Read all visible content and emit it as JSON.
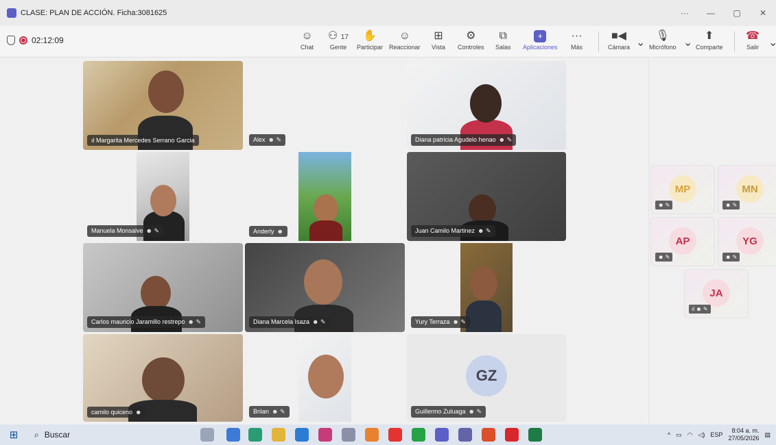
{
  "window": {
    "title": "CLASE: PLAN DE ACCIÓN. Ficha:3081625",
    "controls": [
      "···",
      "—",
      "▢",
      "✕"
    ]
  },
  "meeting": {
    "timer": "02:12:09",
    "participants_count": "17"
  },
  "toolbar": {
    "chat": "Chat",
    "people": "Gente",
    "raise": "Participar",
    "react": "Reaccionar",
    "view": "Vista",
    "controls": "Controles",
    "rooms": "Salas",
    "apps": "Aplicaciones",
    "more": "Más",
    "camera": "Cámara",
    "mic": "Micrófono",
    "share": "Comparte",
    "leave": "Salir"
  },
  "tiles": [
    {
      "name": "Margarita Mercedes Serrano Garcia"
    },
    {
      "name": "Alex"
    },
    {
      "name": "Diana patricia Agudelo henao"
    },
    {
      "name": "Manuela Monsalve"
    },
    {
      "name": "Anderly"
    },
    {
      "name": "Juan Camilo Martinez"
    },
    {
      "name": "Carlos mauricio Jaramillo restrepo"
    },
    {
      "name": "Diana Marcela Isaza"
    },
    {
      "name": "Yury Terraza"
    },
    {
      "name": "camilo quiceno"
    },
    {
      "name": "Briian"
    },
    {
      "name": "Guillermo Zuluaga",
      "initials": "GZ"
    }
  ],
  "side_tiles": [
    {
      "initials": "MP",
      "color": "#d9a441"
    },
    {
      "initials": "MN",
      "color": "#c79a3a"
    },
    {
      "initials": "AP",
      "color": "#c4314b"
    },
    {
      "initials": "YG",
      "color": "#c4314b"
    },
    {
      "initials": "JA",
      "color": "#c4314b"
    }
  ],
  "taskbar": {
    "search": "Buscar",
    "lang": "ESP",
    "time": "8:04 a. m.",
    "date": "27/05/2026"
  }
}
